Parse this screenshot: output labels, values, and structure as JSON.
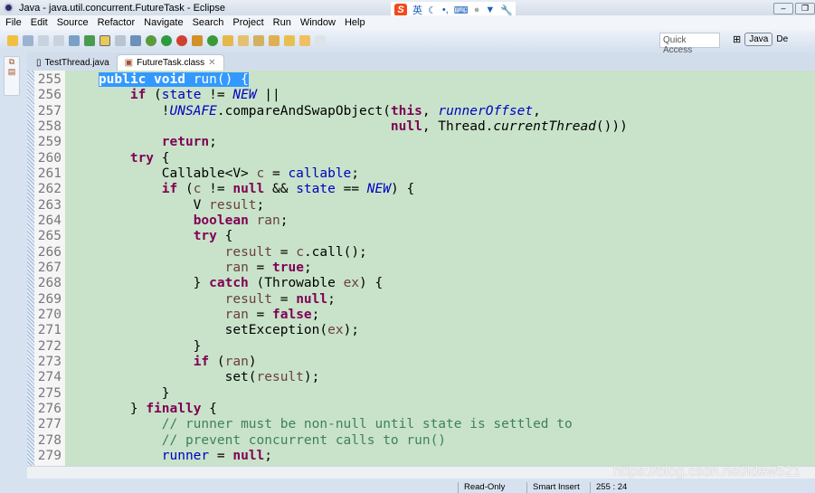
{
  "window": {
    "title": "Java - java.util.concurrent.FutureTask - Eclipse"
  },
  "ime": {
    "label": "英"
  },
  "menu": [
    "File",
    "Edit",
    "Source",
    "Refactor",
    "Navigate",
    "Search",
    "Project",
    "Run",
    "Window",
    "Help"
  ],
  "toolbar": {
    "quick_access_placeholder": "Quick Access",
    "perspectives": [
      "Java",
      "De"
    ]
  },
  "tabs": [
    {
      "label": "TestThread.java",
      "active": false
    },
    {
      "label": "FutureTask.class",
      "active": true
    }
  ],
  "editor": {
    "selection_color": "#3399ff",
    "background_color": "#c8e3c9",
    "lines": [
      {
        "n": "255",
        "t": [
          [
            "p",
            "    "
          ],
          [
            "k",
            "public"
          ],
          [
            "p",
            " "
          ],
          [
            "k",
            "void"
          ],
          [
            "p",
            " run() {"
          ]
        ],
        "sel": true
      },
      {
        "n": "256",
        "t": [
          [
            "p",
            "        "
          ],
          [
            "k",
            "if"
          ],
          [
            "p",
            " ("
          ],
          [
            "f",
            "state"
          ],
          [
            "p",
            " != "
          ],
          [
            "s",
            "NEW"
          ],
          [
            "p",
            " ||"
          ]
        ]
      },
      {
        "n": "257",
        "t": [
          [
            "p",
            "            !"
          ],
          [
            "s",
            "UNSAFE"
          ],
          [
            "p",
            ".compareAndSwapObject("
          ],
          [
            "k",
            "this"
          ],
          [
            "p",
            ", "
          ],
          [
            "s",
            "runnerOffset"
          ],
          [
            "p",
            ","
          ]
        ]
      },
      {
        "n": "258",
        "t": [
          [
            "p",
            "                                         "
          ],
          [
            "k",
            "null"
          ],
          [
            "p",
            ", Thread."
          ],
          [
            "m",
            "currentThread"
          ],
          [
            "p",
            "()))"
          ]
        ]
      },
      {
        "n": "259",
        "t": [
          [
            "p",
            "            "
          ],
          [
            "k",
            "return"
          ],
          [
            "p",
            ";"
          ]
        ]
      },
      {
        "n": "260",
        "t": [
          [
            "p",
            "        "
          ],
          [
            "k",
            "try"
          ],
          [
            "p",
            " {"
          ]
        ]
      },
      {
        "n": "261",
        "t": [
          [
            "p",
            "            Callable<V> "
          ],
          [
            "l",
            "c"
          ],
          [
            "p",
            " = "
          ],
          [
            "f",
            "callable"
          ],
          [
            "p",
            ";"
          ]
        ]
      },
      {
        "n": "262",
        "t": [
          [
            "p",
            "            "
          ],
          [
            "k",
            "if"
          ],
          [
            "p",
            " ("
          ],
          [
            "l",
            "c"
          ],
          [
            "p",
            " != "
          ],
          [
            "k",
            "null"
          ],
          [
            "p",
            " && "
          ],
          [
            "f",
            "state"
          ],
          [
            "p",
            " == "
          ],
          [
            "s",
            "NEW"
          ],
          [
            "p",
            ") {"
          ]
        ]
      },
      {
        "n": "263",
        "t": [
          [
            "p",
            "                V "
          ],
          [
            "l",
            "result"
          ],
          [
            "p",
            ";"
          ]
        ]
      },
      {
        "n": "264",
        "t": [
          [
            "p",
            "                "
          ],
          [
            "k",
            "boolean"
          ],
          [
            "p",
            " "
          ],
          [
            "l",
            "ran"
          ],
          [
            "p",
            ";"
          ]
        ]
      },
      {
        "n": "265",
        "t": [
          [
            "p",
            "                "
          ],
          [
            "k",
            "try"
          ],
          [
            "p",
            " {"
          ]
        ]
      },
      {
        "n": "266",
        "t": [
          [
            "p",
            "                    "
          ],
          [
            "l",
            "result"
          ],
          [
            "p",
            " = "
          ],
          [
            "l",
            "c"
          ],
          [
            "p",
            ".call();"
          ]
        ]
      },
      {
        "n": "267",
        "t": [
          [
            "p",
            "                    "
          ],
          [
            "l",
            "ran"
          ],
          [
            "p",
            " = "
          ],
          [
            "k",
            "true"
          ],
          [
            "p",
            ";"
          ]
        ]
      },
      {
        "n": "268",
        "t": [
          [
            "p",
            "                } "
          ],
          [
            "k",
            "catch"
          ],
          [
            "p",
            " (Throwable "
          ],
          [
            "l",
            "ex"
          ],
          [
            "p",
            ") {"
          ]
        ]
      },
      {
        "n": "269",
        "t": [
          [
            "p",
            "                    "
          ],
          [
            "l",
            "result"
          ],
          [
            "p",
            " = "
          ],
          [
            "k",
            "null"
          ],
          [
            "p",
            ";"
          ]
        ]
      },
      {
        "n": "270",
        "t": [
          [
            "p",
            "                    "
          ],
          [
            "l",
            "ran"
          ],
          [
            "p",
            " = "
          ],
          [
            "k",
            "false"
          ],
          [
            "p",
            ";"
          ]
        ]
      },
      {
        "n": "271",
        "t": [
          [
            "p",
            "                    setException("
          ],
          [
            "l",
            "ex"
          ],
          [
            "p",
            ");"
          ]
        ]
      },
      {
        "n": "272",
        "t": [
          [
            "p",
            "                }"
          ]
        ]
      },
      {
        "n": "273",
        "t": [
          [
            "p",
            "                "
          ],
          [
            "k",
            "if"
          ],
          [
            "p",
            " ("
          ],
          [
            "l",
            "ran"
          ],
          [
            "p",
            ")"
          ]
        ]
      },
      {
        "n": "274",
        "t": [
          [
            "p",
            "                    set("
          ],
          [
            "l",
            "result"
          ],
          [
            "p",
            ");"
          ]
        ]
      },
      {
        "n": "275",
        "t": [
          [
            "p",
            "            }"
          ]
        ]
      },
      {
        "n": "276",
        "t": [
          [
            "p",
            "        } "
          ],
          [
            "k",
            "finally"
          ],
          [
            "p",
            " {"
          ]
        ]
      },
      {
        "n": "277",
        "t": [
          [
            "p",
            "            "
          ],
          [
            "c",
            "// runner must be non-null until state is settled to"
          ]
        ]
      },
      {
        "n": "278",
        "t": [
          [
            "p",
            "            "
          ],
          [
            "c",
            "// prevent concurrent calls to run()"
          ]
        ]
      },
      {
        "n": "279",
        "t": [
          [
            "p",
            "            "
          ],
          [
            "f",
            "runner"
          ],
          [
            "p",
            " = "
          ],
          [
            "k",
            "null"
          ],
          [
            "p",
            ";"
          ]
        ]
      }
    ]
  },
  "watermark": "https://blog.csdn.net/idew521",
  "status": {
    "mode": "Read-Only",
    "insert": "Smart Insert",
    "position": "255 : 24"
  }
}
